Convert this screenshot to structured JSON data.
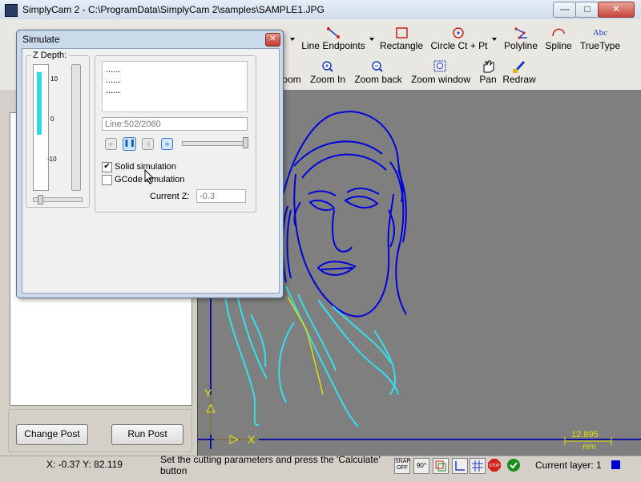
{
  "window": {
    "title": "SimplyCam 2 - C:\\ProgramData\\SimplyCam 2\\samples\\SAMPLE1.JPG",
    "min_label": "—",
    "max_label": "□",
    "close_label": "✕"
  },
  "toolbar": {
    "row1": [
      {
        "label": "Line Endpoints",
        "icon": "line-endpoints-icon"
      },
      {
        "label": "Rectangle",
        "icon": "rectangle-icon"
      },
      {
        "label": "Circle Ct + Pt",
        "icon": "circle-icon"
      },
      {
        "label": "Polyline",
        "icon": "polyline-icon"
      },
      {
        "label": "Spline",
        "icon": "spline-icon"
      },
      {
        "label": "TrueType",
        "icon": "truetype-icon",
        "icon_text": "Abc"
      }
    ],
    "row2": [
      {
        "label": "oom",
        "icon": "zoom-icon"
      },
      {
        "label": "Zoom In",
        "icon": "zoom-in-icon"
      },
      {
        "label": "Zoom back",
        "icon": "zoom-back-icon"
      },
      {
        "label": "Zoom window",
        "icon": "zoom-window-icon"
      },
      {
        "label": "Pan",
        "icon": "pan-hand-icon"
      },
      {
        "label": "Redraw",
        "icon": "redraw-brush-icon"
      }
    ]
  },
  "left_panel": {
    "change_post": "Change Post",
    "run_post": "Run Post"
  },
  "simulate": {
    "title": "Simulate",
    "close_label": "✕",
    "z_depth_label": "Z Depth:",
    "z_ticks": [
      "10",
      "0",
      "-10"
    ],
    "log_lines": [
      "......",
      "......",
      "......"
    ],
    "line_info": "Line:502/2060",
    "solid_simulation": {
      "label": "Solid simulation",
      "checked": true
    },
    "gcode_simulation": {
      "label": "GCode simulation",
      "checked": false
    },
    "current_z_label": "Current Z:",
    "current_z_value": "-0.3",
    "playback_buttons": [
      "rewind",
      "pause",
      "step",
      "fast-forward"
    ]
  },
  "canvas": {
    "scale_value": "12.895",
    "scale_unit": "mm",
    "axis_y": "Y",
    "axis_x": "X",
    "drawing_color": "#0000dd",
    "toolpath_color": "#33e0f0",
    "path_color": "#e0e000"
  },
  "status": {
    "coords": "X: -0.37 Y: 82.119",
    "message": "Set the cutting parameters and press the 'Calculate' button",
    "snap_label": "SNAP OFF",
    "angle_label": "90°",
    "current_layer": "Current layer: 1",
    "layer_color": "#0000cc"
  }
}
